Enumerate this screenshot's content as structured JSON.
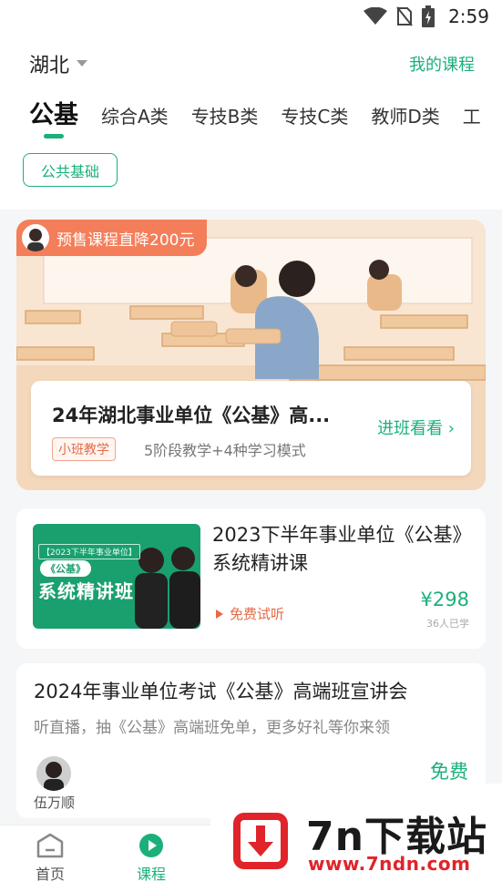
{
  "status_bar": {
    "time": "2:59",
    "icons": [
      "wifi-icon",
      "no-sim-icon",
      "battery-charging-icon"
    ]
  },
  "header": {
    "city": "湖北",
    "my_courses": "我的课程"
  },
  "tabs": [
    {
      "label": "公基",
      "active": true
    },
    {
      "label": "综合A类",
      "active": false
    },
    {
      "label": "专技B类",
      "active": false
    },
    {
      "label": "专技C类",
      "active": false
    },
    {
      "label": "教师D类",
      "active": false
    },
    {
      "label": "工",
      "active": false
    }
  ],
  "filter_chip": "公共基础",
  "banner": {
    "promo": "预售课程直降200元",
    "title": "24年湖北事业单位《公基》高...",
    "tag": "小班教学",
    "desc": "5阶段教学+4种学习模式",
    "action": "进班看看 ›"
  },
  "course1": {
    "thumb_small": "【2023下半年事业单位】",
    "thumb_pill": "《公基》",
    "thumb_big": "系统精讲班",
    "title": "2023下半年事业单位《公基》系统精讲课",
    "free_listen": "免费试听",
    "price": "¥298",
    "learners": "36人已学"
  },
  "course2": {
    "title": "2024年事业单位考试《公基》高端班宣讲会",
    "desc": "听直播，抽《公基》高端班免单，更多好礼等你来领",
    "teacher": "伍万顺",
    "price": "免费"
  },
  "tabbar": {
    "home": "首页",
    "course": "课程"
  },
  "watermark": {
    "line1": "7n下载站",
    "line2": "www.7ndn.com"
  },
  "colors": {
    "accent": "#1bb07a",
    "promo": "#f47e59",
    "watermark_red": "#e0242a"
  }
}
